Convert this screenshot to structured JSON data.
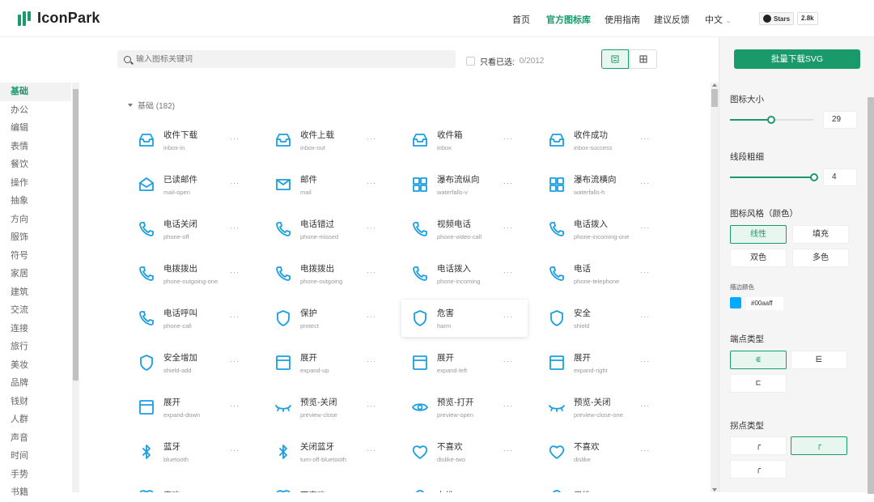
{
  "brand": {
    "name": "IconPark",
    "color": "#1a9a6b"
  },
  "nav": {
    "items": [
      "首页",
      "官方图标库",
      "使用指南",
      "建议反馈",
      "中文"
    ],
    "active": "官方图标库",
    "github_label": "Stars",
    "github_count": "2.8k"
  },
  "search": {
    "placeholder": "输入图标关键词"
  },
  "filter": {
    "only_selected_label": "只看已选:",
    "only_selected_count": "0/2012"
  },
  "sidebar": {
    "items": [
      "基础",
      "办公",
      "编辑",
      "表情",
      "餐饮",
      "操作",
      "抽象",
      "方向",
      "服饰",
      "符号",
      "家居",
      "建筑",
      "交流",
      "连接",
      "旅行",
      "美妆",
      "品牌",
      "钱财",
      "人群",
      "声音",
      "时间",
      "手势",
      "书籍"
    ],
    "active": "基础"
  },
  "group": {
    "title": "基础 (182)"
  },
  "icons": [
    {
      "cn": "收件下载",
      "en": "inbox-in",
      "icon": "inbox-in-icon"
    },
    {
      "cn": "收件上载",
      "en": "inbox-out",
      "icon": "inbox-out-icon"
    },
    {
      "cn": "收件箱",
      "en": "inbox",
      "icon": "inbox-icon"
    },
    {
      "cn": "收件成功",
      "en": "inbox-success",
      "icon": "inbox-success-icon"
    },
    {
      "cn": "已读邮件",
      "en": "mail-open",
      "icon": "mail-open-icon"
    },
    {
      "cn": "邮件",
      "en": "mail",
      "icon": "mail-icon"
    },
    {
      "cn": "瀑布流纵向",
      "en": "waterfalls-v",
      "icon": "waterfalls-v-icon"
    },
    {
      "cn": "瀑布流横向",
      "en": "waterfalls-h",
      "icon": "waterfalls-h-icon"
    },
    {
      "cn": "电话关闭",
      "en": "phone-off",
      "icon": "phone-off-icon"
    },
    {
      "cn": "电话错过",
      "en": "phone-missed",
      "icon": "phone-missed-icon"
    },
    {
      "cn": "视频电话",
      "en": "phone-video-call",
      "icon": "phone-video-call-icon"
    },
    {
      "cn": "电话拨入",
      "en": "phone-incoming-one",
      "icon": "phone-incoming-one-icon"
    },
    {
      "cn": "电拨拨出",
      "en": "phone-outgoing-one",
      "icon": "phone-outgoing-one-icon"
    },
    {
      "cn": "电拨拨出",
      "en": "phone-outgoing",
      "icon": "phone-outgoing-icon"
    },
    {
      "cn": "电话拨入",
      "en": "phone-incoming",
      "icon": "phone-incoming-icon"
    },
    {
      "cn": "电话",
      "en": "phone-telephone",
      "icon": "phone-telephone-icon"
    },
    {
      "cn": "电话呼叫",
      "en": "phone-call",
      "icon": "phone-call-icon"
    },
    {
      "cn": "保护",
      "en": "protect",
      "icon": "protect-icon"
    },
    {
      "cn": "危害",
      "en": "harm",
      "icon": "harm-icon"
    },
    {
      "cn": "安全",
      "en": "shield",
      "icon": "shield-icon"
    },
    {
      "cn": "安全增加",
      "en": "shield-add",
      "icon": "shield-add-icon"
    },
    {
      "cn": "展开",
      "en": "expand-up",
      "icon": "expand-up-icon"
    },
    {
      "cn": "展开",
      "en": "expand-left",
      "icon": "expand-left-icon"
    },
    {
      "cn": "展开",
      "en": "expand-right",
      "icon": "expand-right-icon"
    },
    {
      "cn": "展开",
      "en": "expand-down",
      "icon": "expand-down-icon"
    },
    {
      "cn": "预览-关闭",
      "en": "preview-close",
      "icon": "preview-close-icon"
    },
    {
      "cn": "预览-打开",
      "en": "preview-open",
      "icon": "preview-open-icon"
    },
    {
      "cn": "预览-关闭",
      "en": "preview-close-one",
      "icon": "preview-close-one-icon"
    },
    {
      "cn": "蓝牙",
      "en": "bluetooth",
      "icon": "bluetooth-icon"
    },
    {
      "cn": "关闭蓝牙",
      "en": "turn-off-bluetooth",
      "icon": "turn-off-bluetooth-icon"
    },
    {
      "cn": "不喜欢",
      "en": "dislike-two",
      "icon": "dislike-two-icon"
    },
    {
      "cn": "不喜欢",
      "en": "dislike",
      "icon": "dislike-icon"
    },
    {
      "cn": "喜欢",
      "en": "",
      "icon": "like-icon"
    },
    {
      "cn": "不喜欢",
      "en": "",
      "icon": "dislike-icon"
    },
    {
      "cn": "女性",
      "en": "",
      "icon": "female-icon"
    },
    {
      "cn": "男性",
      "en": "",
      "icon": "male-icon"
    }
  ],
  "icon_color": "#1a9fe0",
  "panel": {
    "download_label": "批量下载SVG",
    "size_label": "图标大小",
    "size_value": "29",
    "size_fraction": 0.49,
    "stroke_label": "线段粗细",
    "stroke_value": "4",
    "stroke_fraction": 1.0,
    "style_label": "图标风格（颜色）",
    "styles": [
      "线性",
      "填充",
      "双色",
      "多色"
    ],
    "style_active": "线性",
    "stroke_color_label": "描边颜色",
    "stroke_color": "#00aaff",
    "linecap_label": "端点类型",
    "linejoin_label": "拐点类型"
  }
}
